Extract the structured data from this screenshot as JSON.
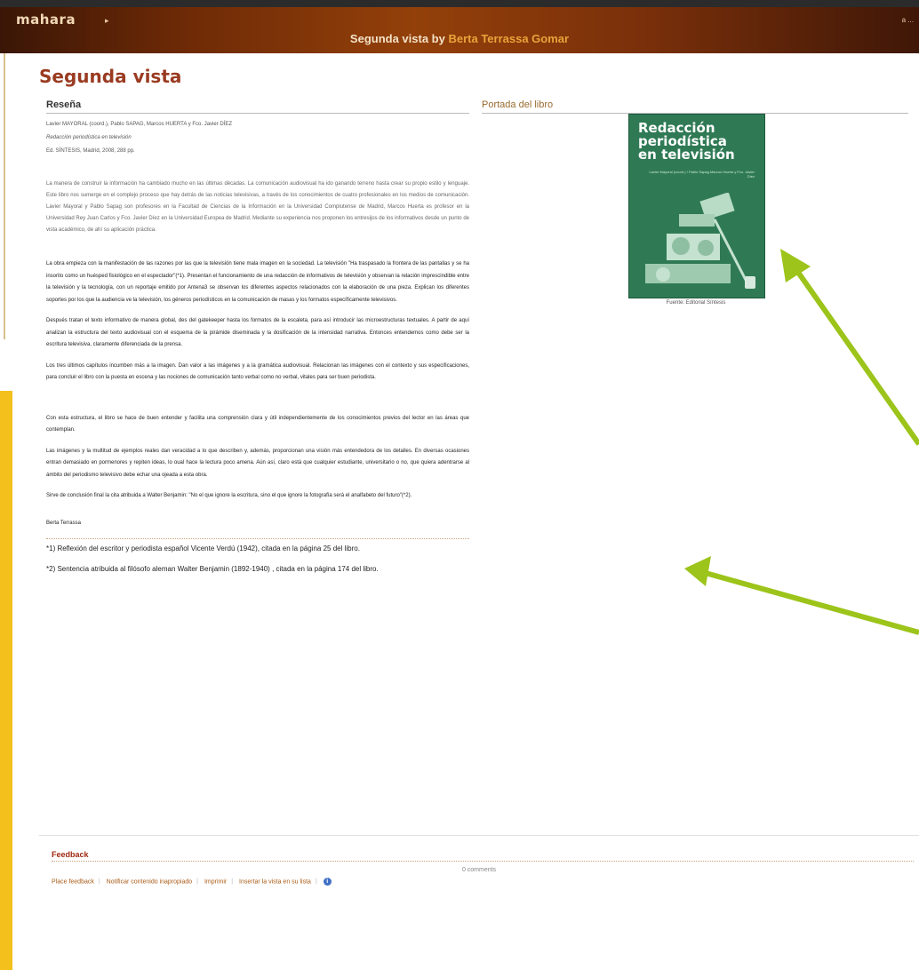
{
  "header": {
    "logo": "mahara",
    "title_prefix": "Segunda vista by ",
    "title_owner": "Berta Terrassa Gomar",
    "right_text": "a ..."
  },
  "page": {
    "title": "Segunda vista"
  },
  "review": {
    "heading": "Reseña",
    "authors": "Lavier MAYORAL (coord.), Pablo SAPAG, Marcos HUERTA y Fco. Javier DÍEZ",
    "book_title": "Redacción periodística en televisión",
    "publisher": "Ed. SÍNTESIS, Madrid, 2008, 288 pp.",
    "intro": "La manera de construir la información ha cambiado mucho en las últimas décadas. La comunicación audiovisual ha ido ganando terreno hasta crear su propio estilo y lenguaje. Este libro nos sumerge en el complejo proceso que hay detrás de las noticias televisivas, a través de los conocimientos de cuatro profesionales en los medios de comunicación. Lavier Mayoral y Pablo Sapag son profesores en la Facultad de Ciencias de la Información en la Universidad Complutense de Madrid, Marcos Huerta es profesor en la Universidad Rey Juan Carlos y Fco. Javier Díez en la Universidad Europea de Madrid. Mediante su experiencia nos proponen los entresijos de los informativos desde un punto de vista académico, de ahí su aplicación práctica.",
    "p1": "La obra empieza con la manifestación de las razones por las que la televisión tiene mala imagen en la sociedad. La televisión \"Ha traspasado la frontera de las pantallas y se ha insorito como un huésped fisiológico en el espectador\"(*1). Presentan el funcionamiento de una redacción de informativos de televisión y observan la relación imprescindible entre la televisión y la tecnología, con un reportaje emitido por Antena3 se observan los diferentes aspectos relacionados con la elaboración de una pieza. Explican los diferentes soportes por los que la audiencia ve la televisión, los géneros periodísticos en la comunicación de masas y los formatos específicamente televisivos.",
    "p2": "Después tratan el texto informativo de manera global, des del gatekeeper hasta los formatos de la escaleta, para así introducir las microestructuras textuales. A partir de aquí analizan la estructura del texto audiovisual con el esquema de la pirámide diseminada y la dosificación de la intensidad narrativa. Entonces entendemos como debe ser la escritura televisiva, claramente diferenciada de la prensa.",
    "p3": "Los tres últimos capítulos incumben más a la imagen. Dan valor a las imágenes y a la gramática audiovisual. Relacionan las imágenes con el contexto y sus especificaciones, para concluir el libro con la puesta en escena y las nociones de comunicación tanto verbal como no verbal, vitales para ser buen periodista.",
    "p4": "Con esta estructura, el libro se hace de buen entender y facilita una comprensión clara y útil independientemente de los conocimientos previos del lector en las áreas que contemplan.",
    "p5": "Las imágenes y la multitud de ejemplos reales dan veracidad a lo que describen y, además, proporcionan una visión más entendedora de los detalles. En diversas ocasiones entran demasiado en pormenores y repiten ideas, lo oual hace la lectura poco amena. Aún así, claro está que cualquier estudiante, universitario o no, que quiera adentrarse al ámbito del periodismo televisivo debe echar una ojeada a esta obra.",
    "p6": "Sirve de conclusión final la cita atribuida a Walter Benjamin: \"No el que ignore la escritura, sino el que ignore la fotografía será el analfabeto del futuro\"(*2).",
    "signature": "Berta Terrassa",
    "footnote1": "*1) Reflexión del escritor y periodista español Vicente Verdú (1942), citada en la página 25 del libro.",
    "footnote2": "*2) Sentencia atribuida al filósofo aleman Walter Benjamin (1892-1940) , citada en la página 174 del libro."
  },
  "cover": {
    "heading": "Portada del libro",
    "cover_title_1": "Redacción",
    "cover_title_2": "periodística",
    "cover_title_3": "en televisión",
    "cover_authors": "Lavier Mayoral (coord.) / Pablo Sapag Marcos Huerta y Fco. Javier Díez",
    "caption": "Fuente: Editorial Síntesis"
  },
  "feedback": {
    "heading": "Feedback",
    "count": "0 comments",
    "links": [
      "Place feedback",
      "Notificar contenido inapropiado",
      "Imprimir",
      "Insertar la vista en su lista"
    ],
    "info_icon": "i"
  },
  "colors": {
    "arrow": "#9cc41a",
    "accent": "#f3c01c",
    "title": "#9a3b21"
  },
  "icons": [
    "info-icon"
  ]
}
